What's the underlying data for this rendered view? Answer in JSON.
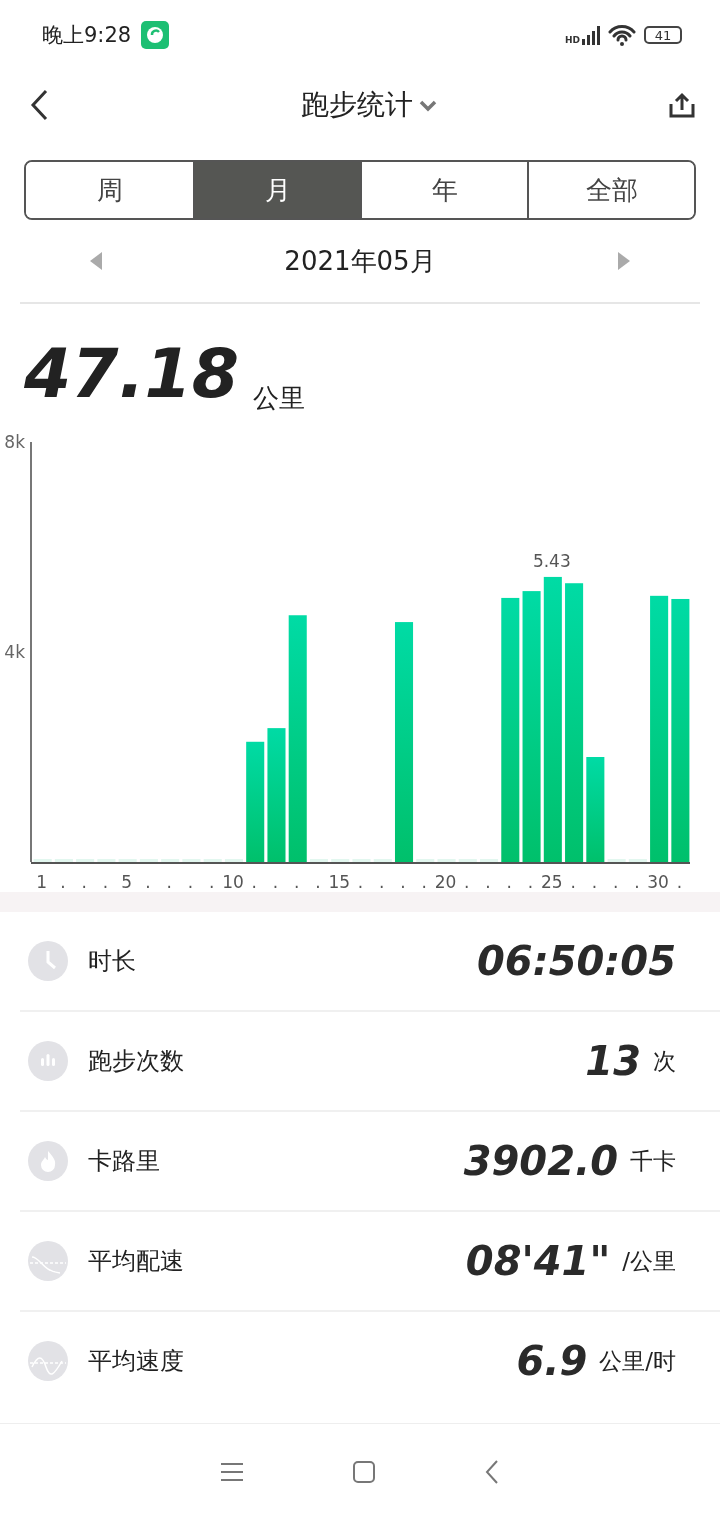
{
  "status_bar": {
    "time": "晚上9:28",
    "network_badge": "HD",
    "battery": "41"
  },
  "header": {
    "title": "跑步统计"
  },
  "tabs": [
    {
      "label": "周",
      "selected": false
    },
    {
      "label": "月",
      "selected": true
    },
    {
      "label": "年",
      "selected": false
    },
    {
      "label": "全部",
      "selected": false
    }
  ],
  "period": {
    "label": "2021年05月"
  },
  "summary": {
    "value": "47.18",
    "unit": "公里"
  },
  "chart_data": {
    "type": "bar",
    "categories": [
      "1",
      ".",
      ".",
      ".",
      "5",
      ".",
      ".",
      ".",
      ".",
      "10",
      ".",
      ".",
      ".",
      ".",
      "15",
      ".",
      ".",
      ".",
      ".",
      "20",
      ".",
      ".",
      ".",
      ".",
      "25",
      ".",
      ".",
      ".",
      ".",
      "30",
      "."
    ],
    "values": [
      0,
      0,
      0,
      0,
      0,
      0,
      0,
      0,
      0,
      0,
      2.29,
      2.55,
      4.7,
      0,
      0,
      0,
      0,
      4.57,
      0,
      0,
      0,
      0,
      5.03,
      5.16,
      5.43,
      5.31,
      2.0,
      0,
      0,
      5.07,
      5.01
    ],
    "ylim": [
      0,
      8
    ],
    "yticks": [
      {
        "value": 4,
        "label": "4k"
      },
      {
        "value": 8,
        "label": "8k"
      }
    ],
    "annotations": [
      "5.43"
    ]
  },
  "stats": [
    {
      "kind": "clock",
      "label": "时长",
      "value": "06:50:05"
    },
    {
      "kind": "bars",
      "label": "跑步次数",
      "value": "13",
      "unit": "次"
    },
    {
      "kind": "flame",
      "label": "卡路里",
      "value": "3902.0",
      "unit": "千卡"
    },
    {
      "kind": "pace",
      "label": "平均配速",
      "value": "08'41\"",
      "unit": "/公里"
    },
    {
      "kind": "speed",
      "label": "平均速度",
      "value": "6.9",
      "unit": "公里/时"
    }
  ]
}
